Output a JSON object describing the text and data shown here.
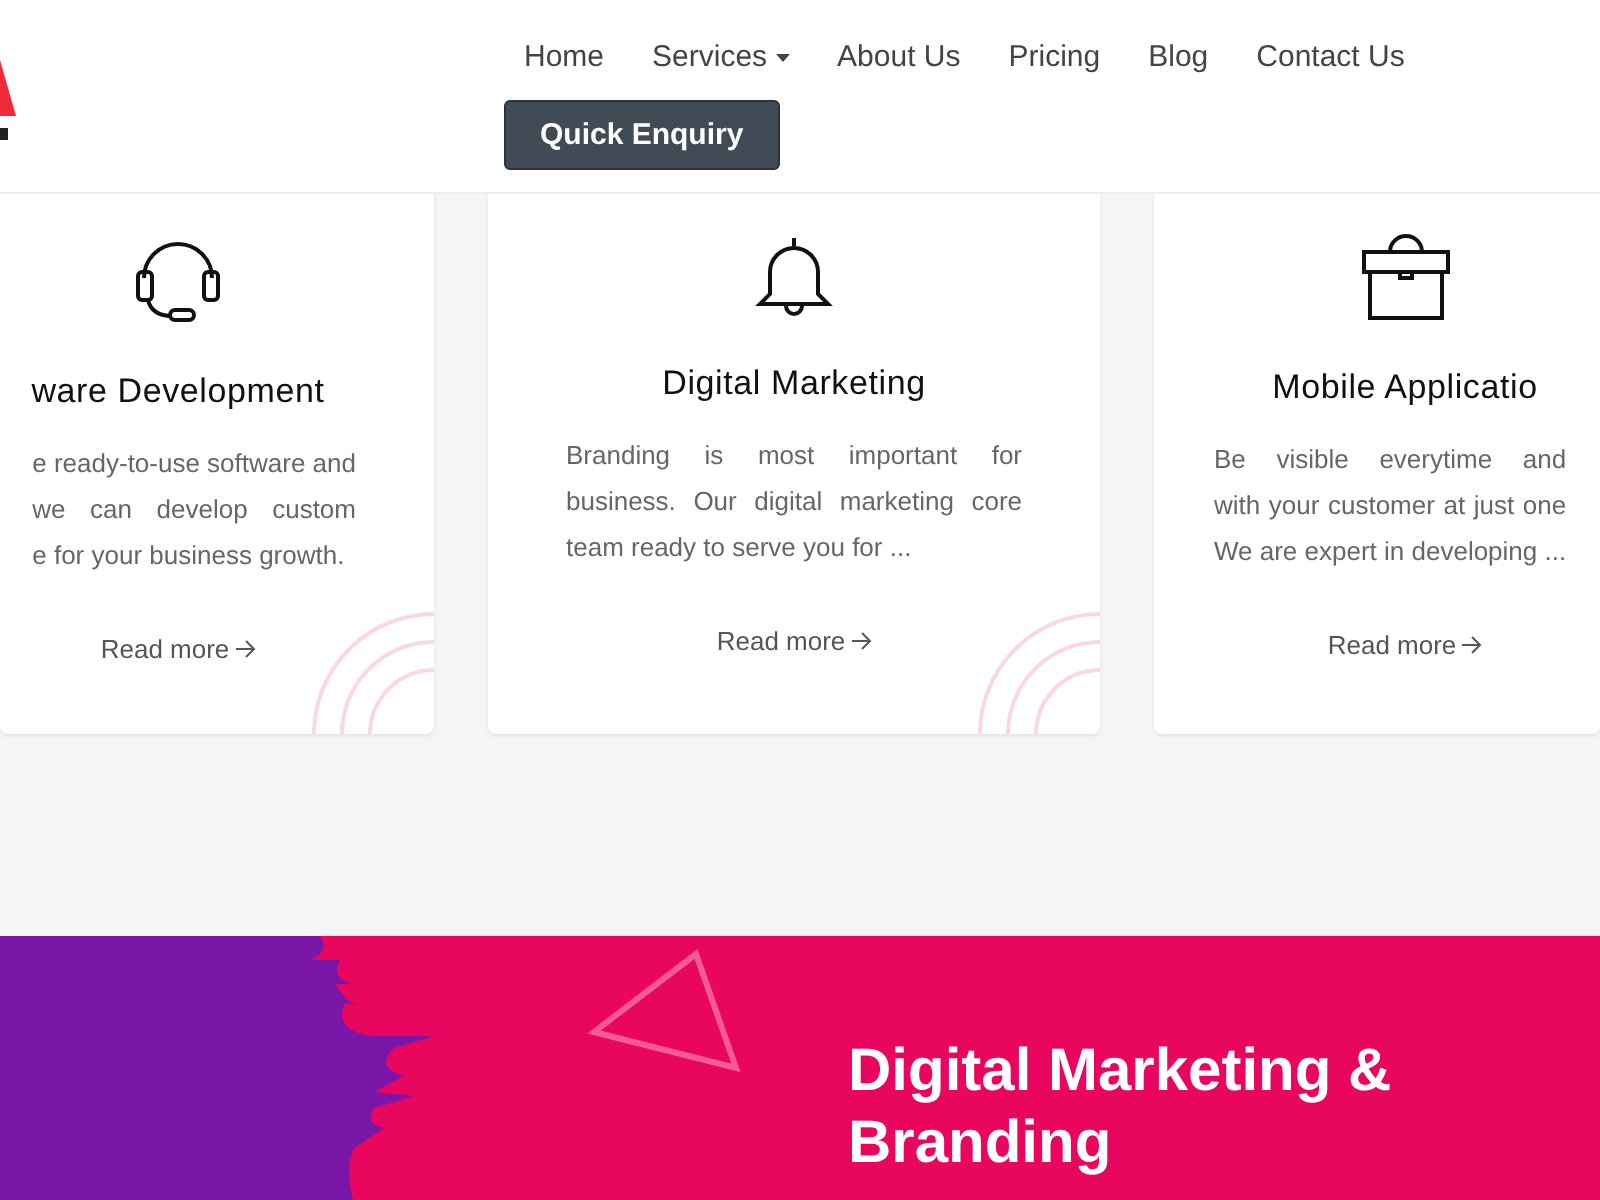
{
  "nav": {
    "items": [
      {
        "label": "Home",
        "dropdown": false
      },
      {
        "label": "Services",
        "dropdown": true
      },
      {
        "label": "About Us",
        "dropdown": false
      },
      {
        "label": "Pricing",
        "dropdown": false
      },
      {
        "label": "Blog",
        "dropdown": false
      },
      {
        "label": "Contact Us",
        "dropdown": false
      }
    ],
    "button": "Quick Enquiry"
  },
  "cards": [
    {
      "kind": "headset",
      "title": "ware Development",
      "lines": [
        "e ready-to-use software and",
        "we can develop custom",
        "e for your business growth."
      ],
      "link": "Read more"
    },
    {
      "kind": "bell",
      "title": "Digital Marketing",
      "lines": [
        "Branding is most important for",
        "business. Our digital marketing core",
        "team ready to serve you for ..."
      ],
      "link": "Read more"
    },
    {
      "kind": "briefcase",
      "title": "Mobile Applicatio",
      "lines": [
        "Be visible everytime and",
        "with your customer at just one",
        "We are expert in developing ..."
      ],
      "link": "Read more"
    }
  ],
  "banner": {
    "heading": "Digital Marketing & Branding"
  }
}
